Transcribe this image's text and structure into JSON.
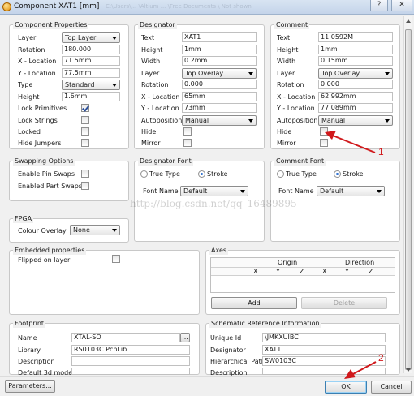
{
  "window": {
    "title": "Component XAT1 [mm]",
    "ghost_text": "C:\\Users\\... \\Altium ... \\Free Documents \\ Not shown",
    "help_glyph": "?",
    "close_glyph": "✕"
  },
  "component_properties": {
    "title": "Component Properties",
    "layer": {
      "label": "Layer",
      "value": "Top Layer"
    },
    "rotation": {
      "label": "Rotation",
      "value": "180.000"
    },
    "x_location": {
      "label": "X - Location",
      "value": "71.5mm"
    },
    "y_location": {
      "label": "Y - Location",
      "value": "77.5mm"
    },
    "type": {
      "label": "Type",
      "value": "Standard"
    },
    "height": {
      "label": "Height",
      "value": "1.6mm"
    },
    "lock_primitives": {
      "label": "Lock Primitives",
      "checked": true
    },
    "lock_strings": {
      "label": "Lock Strings",
      "checked": false
    },
    "locked": {
      "label": "Locked",
      "checked": false
    },
    "hide_jumpers": {
      "label": "Hide Jumpers",
      "checked": false
    }
  },
  "designator": {
    "title": "Designator",
    "text": {
      "label": "Text",
      "value": "XAT1"
    },
    "height": {
      "label": "Height",
      "value": "1mm"
    },
    "width": {
      "label": "Width",
      "value": "0.2mm"
    },
    "layer": {
      "label": "Layer",
      "value": "Top Overlay"
    },
    "rotation": {
      "label": "Rotation",
      "value": "0.000"
    },
    "x_location": {
      "label": "X - Location",
      "value": "65mm"
    },
    "y_location": {
      "label": "Y - Location",
      "value": "73mm"
    },
    "autoposition": {
      "label": "Autoposition",
      "value": "Manual"
    },
    "hide": {
      "label": "Hide",
      "checked": false
    },
    "mirror": {
      "label": "Mirror",
      "checked": false
    }
  },
  "comment": {
    "title": "Comment",
    "text": {
      "label": "Text",
      "value": "11.0592M"
    },
    "height": {
      "label": "Height",
      "value": "1mm"
    },
    "width": {
      "label": "Width",
      "value": "0.15mm"
    },
    "layer": {
      "label": "Layer",
      "value": "Top Overlay"
    },
    "rotation": {
      "label": "Rotation",
      "value": "0.000"
    },
    "x_location": {
      "label": "X - Location",
      "value": "62.992mm"
    },
    "y_location": {
      "label": "Y - Location",
      "value": "77.089mm"
    },
    "autoposition": {
      "label": "Autoposition",
      "value": "Manual"
    },
    "hide": {
      "label": "Hide",
      "checked": false
    },
    "mirror": {
      "label": "Mirror",
      "checked": false
    }
  },
  "swapping": {
    "title": "Swapping Options",
    "pin_swaps": {
      "label": "Enable Pin Swaps",
      "checked": false
    },
    "part_swaps": {
      "label": "Enabled Part Swaps",
      "checked": false
    }
  },
  "designator_font": {
    "title": "Designator Font",
    "true_type": "True Type",
    "stroke": "Stroke",
    "font_name_label": "Font Name",
    "font_name": "Default"
  },
  "comment_font": {
    "title": "Comment Font",
    "true_type": "True Type",
    "stroke": "Stroke",
    "font_name_label": "Font Name",
    "font_name": "Default"
  },
  "fpga": {
    "title": "FPGA",
    "colour_overlay_label": "Colour Overlay",
    "colour_overlay": "None"
  },
  "embedded": {
    "title": "Embedded properties",
    "flipped_label": "Flipped on layer",
    "flipped": false
  },
  "axes": {
    "title": "Axes",
    "group_origin": "Origin",
    "group_direction": "Direction",
    "columns": [
      "X",
      "Y",
      "Z",
      "X",
      "Y",
      "Z"
    ],
    "add_label": "Add",
    "delete_label": "Delete"
  },
  "footprint": {
    "title": "Footprint",
    "name": {
      "label": "Name",
      "value": "XTAL-SO"
    },
    "library": {
      "label": "Library",
      "value": "RS0103C.PcbLib"
    },
    "description": {
      "label": "Description",
      "value": ""
    },
    "default_3d": {
      "label": "Default 3d model",
      "value": ""
    },
    "browse_label": "..."
  },
  "schematic_ref": {
    "title": "Schematic Reference Information",
    "unique_id": {
      "label": "Unique Id",
      "value": "\\JMKXUIBC"
    },
    "designator": {
      "label": "Designator",
      "value": "XAT1"
    },
    "hier_path": {
      "label": "Hierarchical Path",
      "value": "SW0103C"
    },
    "description": {
      "label": "Description",
      "value": ""
    }
  },
  "buttons": {
    "parameters": "Parameters...",
    "ok": "OK",
    "cancel": "Cancel"
  },
  "watermark": "http://blog.csdn.net/qq_16489895",
  "annotations": {
    "one": "1",
    "two": "2"
  },
  "colors": {
    "annotation_red": "#d0191c",
    "window_bg": "#f0f0f0"
  }
}
